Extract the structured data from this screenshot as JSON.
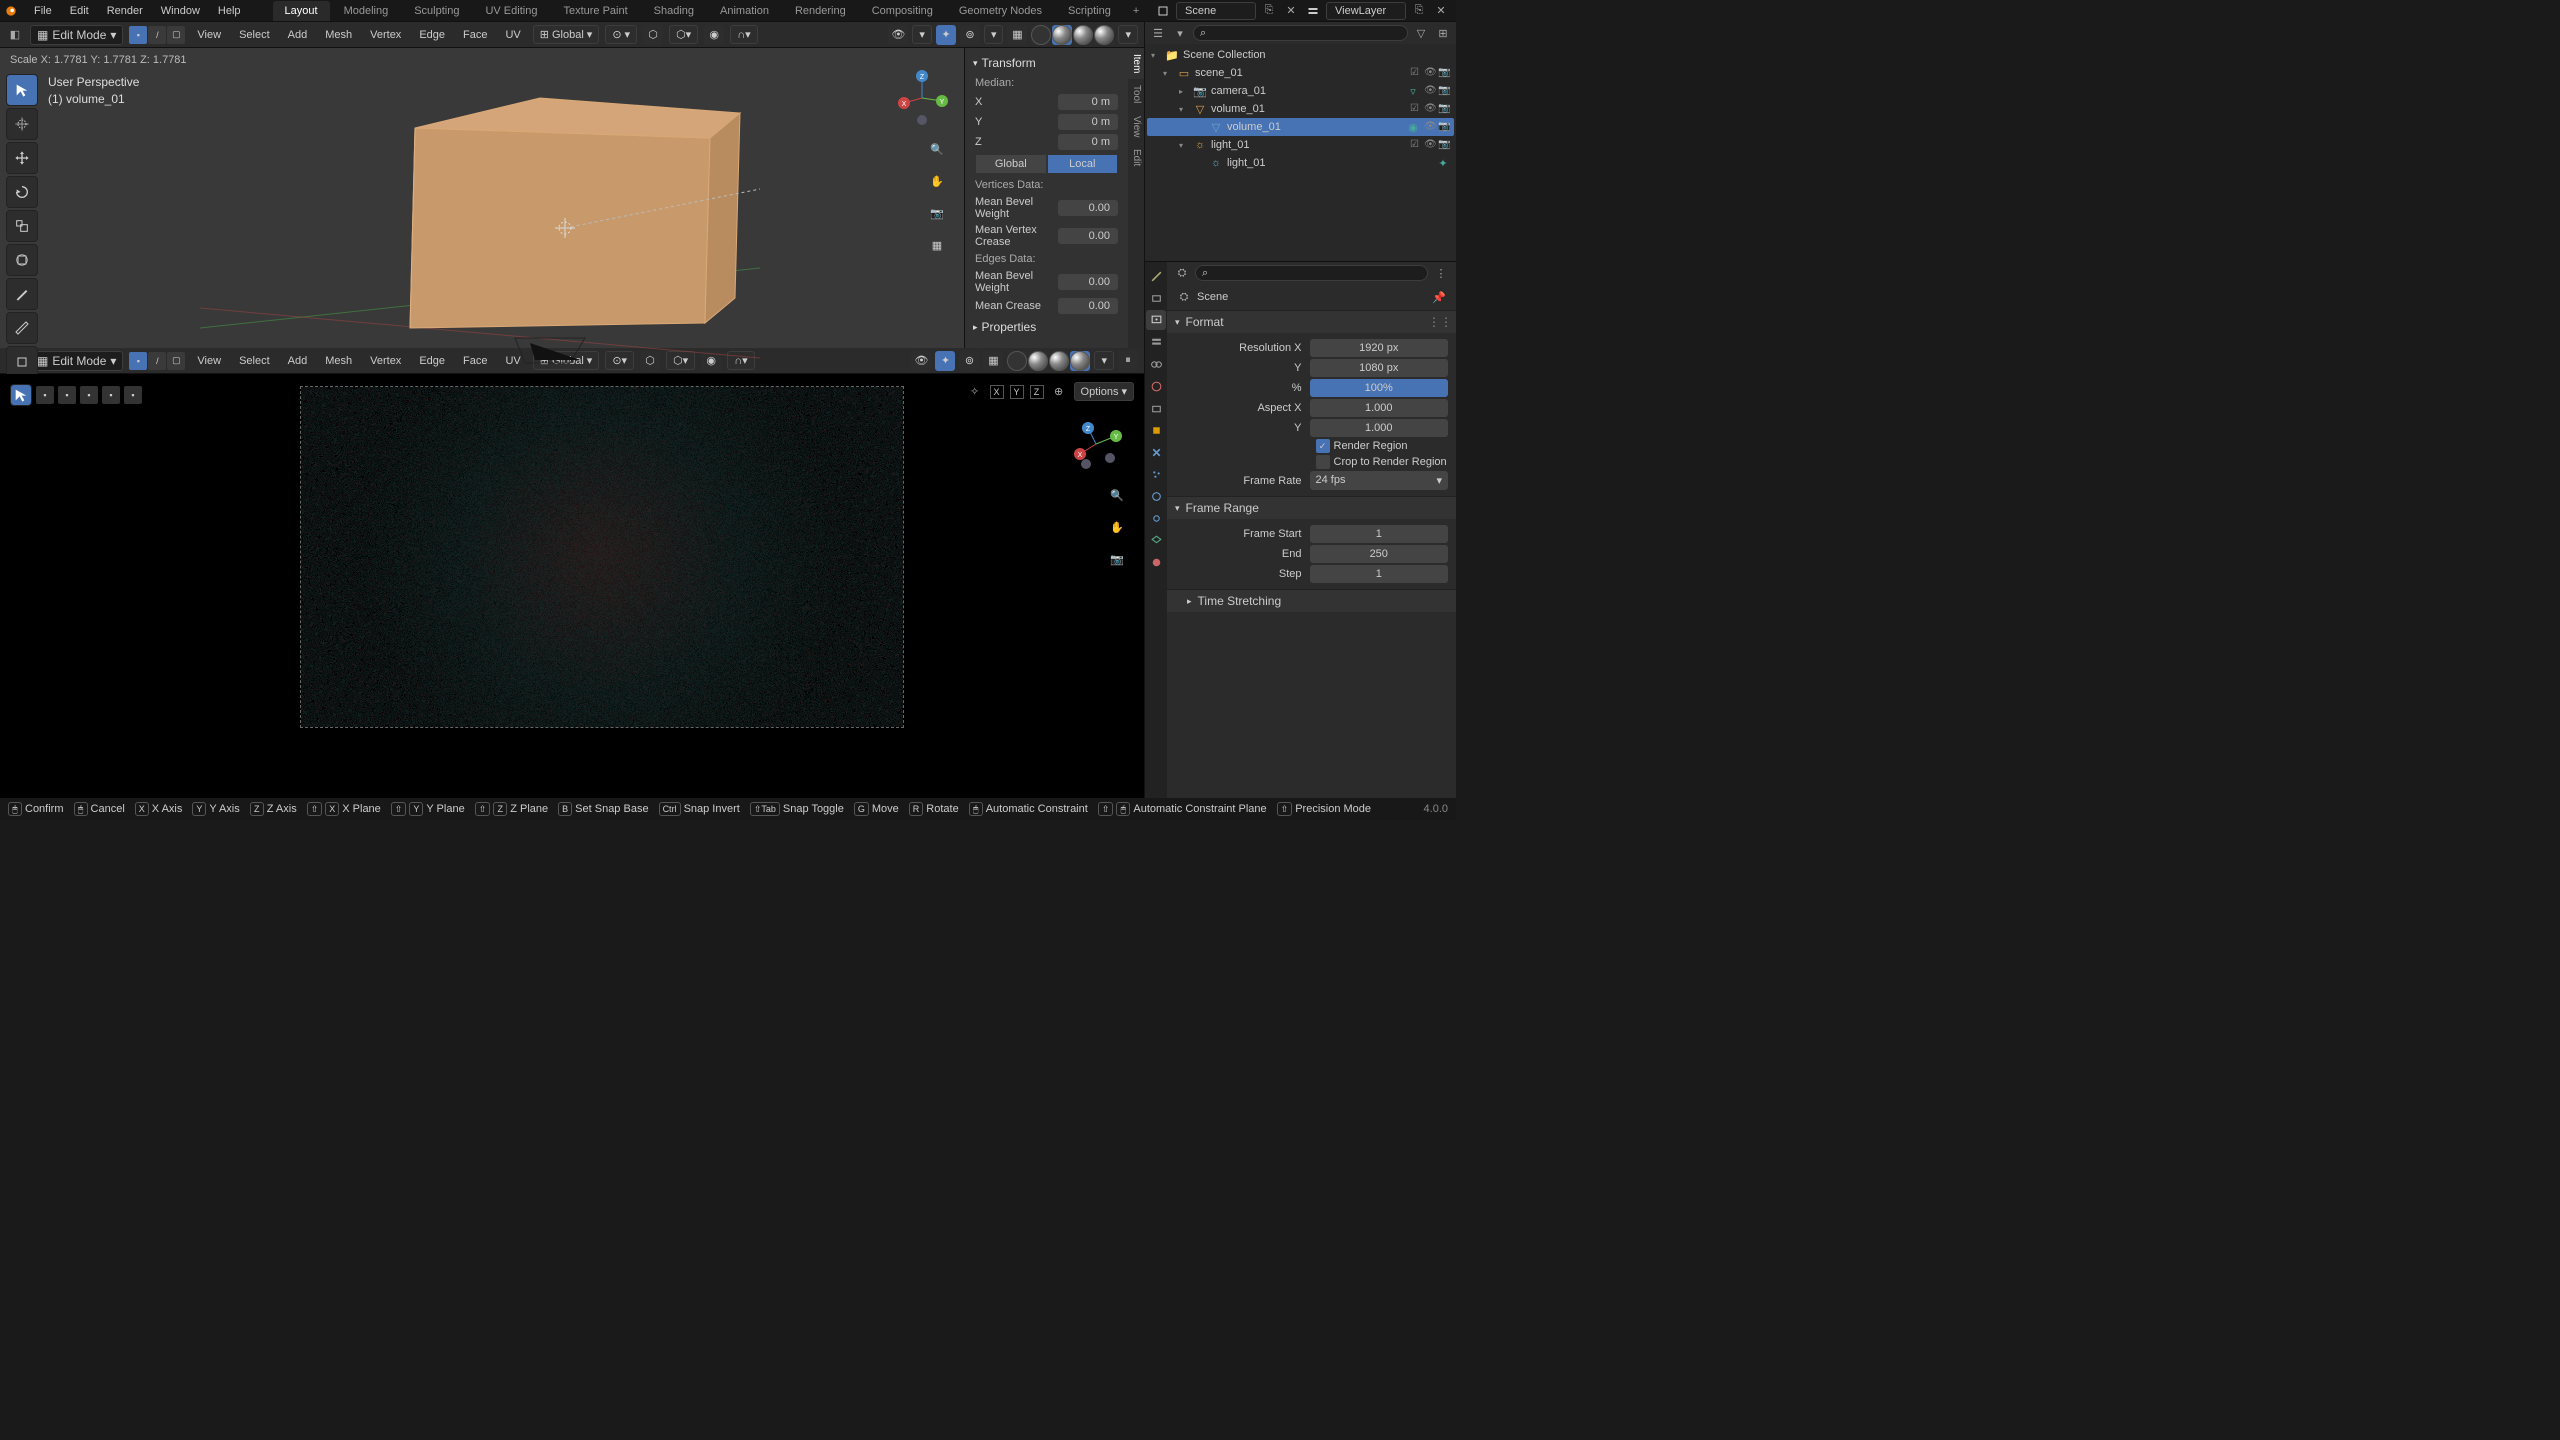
{
  "topbar": {
    "menus": [
      "File",
      "Edit",
      "Render",
      "Window",
      "Help"
    ],
    "workspaces": [
      "Layout",
      "Modeling",
      "Sculpting",
      "UV Editing",
      "Texture Paint",
      "Shading",
      "Animation",
      "Rendering",
      "Compositing",
      "Geometry Nodes",
      "Scripting"
    ],
    "active_ws": "Layout",
    "scene_label": "Scene",
    "viewlayer_label": "ViewLayer"
  },
  "viewport_top": {
    "mode": "Edit Mode",
    "menus": [
      "View",
      "Select",
      "Add",
      "Mesh",
      "Vertex",
      "Edge",
      "Face",
      "UV"
    ],
    "orientation": "Global",
    "status": "Scale X: 1.7781   Y: 1.7781   Z: 1.7781",
    "persp1": "User Perspective",
    "persp2": "(1) volume_01"
  },
  "npanel": {
    "tabs": [
      "Item",
      "Tool",
      "View",
      "Edit"
    ],
    "transform_hdr": "Transform",
    "median": "Median:",
    "x_label": "X",
    "x_val": "0 m",
    "y_label": "Y",
    "y_val": "0 m",
    "z_label": "Z",
    "z_val": "0 m",
    "global": "Global",
    "local": "Local",
    "vd": "Vertices Data:",
    "mbw": "Mean Bevel Weight",
    "mbw_v": "0.00",
    "mvc": "Mean Vertex Crease",
    "mvc_v": "0.00",
    "ed": "Edges Data:",
    "mbe": "Mean Bevel Weight",
    "mbe_v": "0.00",
    "mcr": "Mean Crease",
    "mcr_v": "0.00",
    "props_hdr": "Properties"
  },
  "viewport_bottom": {
    "mode": "Edit Mode",
    "menus": [
      "View",
      "Select",
      "Add",
      "Mesh",
      "Vertex",
      "Edge",
      "Face",
      "UV"
    ],
    "orientation": "Global",
    "axes": [
      "X",
      "Y",
      "Z"
    ],
    "options": "Options"
  },
  "outliner": {
    "root": "Scene Collection",
    "items": [
      {
        "name": "scene_01",
        "depth": 1,
        "type": "collection",
        "expanded": true,
        "selected": false
      },
      {
        "name": "camera_01",
        "depth": 2,
        "type": "camera",
        "expanded": false,
        "selected": false,
        "has_data": true
      },
      {
        "name": "volume_01",
        "depth": 2,
        "type": "mesh",
        "expanded": true,
        "selected": false
      },
      {
        "name": "volume_01",
        "depth": 3,
        "type": "data",
        "expanded": false,
        "selected": true,
        "has_mat": true
      },
      {
        "name": "light_01",
        "depth": 2,
        "type": "light",
        "expanded": true,
        "selected": false
      },
      {
        "name": "light_01",
        "depth": 3,
        "type": "data",
        "expanded": false,
        "selected": false,
        "has_mat": true
      }
    ]
  },
  "props": {
    "scene_crumb": "Scene",
    "format_hdr": "Format",
    "res_x_l": "Resolution X",
    "res_x": "1920 px",
    "res_y_l": "Y",
    "res_y": "1080 px",
    "pct_l": "%",
    "pct": "100%",
    "asp_x_l": "Aspect X",
    "asp_x": "1.000",
    "asp_y_l": "Y",
    "asp_y": "1.000",
    "rr": "Render Region",
    "ctr": "Crop to Render Region",
    "fr_l": "Frame Rate",
    "fr": "24 fps",
    "frange_hdr": "Frame Range",
    "fs_l": "Frame Start",
    "fs": "1",
    "fe_l": "End",
    "fe": "250",
    "fstep_l": "Step",
    "fstep": "1",
    "ts_hdr": "Time Stretching"
  },
  "statusbar": {
    "confirm": "Confirm",
    "cancel": "Cancel",
    "xaxis": "X Axis",
    "yaxis": "Y Axis",
    "zaxis": "Z Axis",
    "xplane": "X Plane",
    "yplane": "Y Plane",
    "zplane": "Z Plane",
    "ssb": "Set Snap Base",
    "si": "Snap Invert",
    "st": "Snap Toggle",
    "move": "Move",
    "rotate": "Rotate",
    "ac": "Automatic Constraint",
    "acp": "Automatic Constraint Plane",
    "pm": "Precision Mode",
    "version": "4.0.0"
  }
}
